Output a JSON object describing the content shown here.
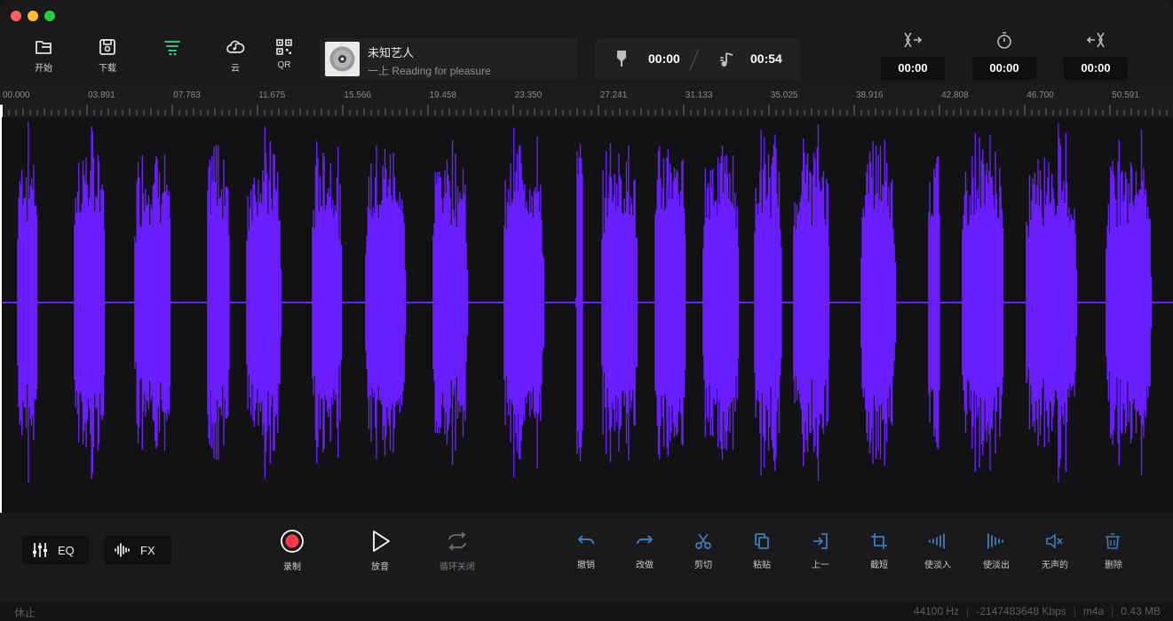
{
  "window": {
    "controls": [
      "close",
      "minimize",
      "zoom"
    ]
  },
  "toolbar": {
    "items": [
      {
        "label": "开始",
        "icon": "folder-open-icon",
        "active": false
      },
      {
        "label": "下载",
        "icon": "save-icon",
        "active": false
      },
      {
        "label": "",
        "icon": "filter-list-icon",
        "active": true
      },
      {
        "label": "云",
        "icon": "cloud-music-icon",
        "active": false
      },
      {
        "label": "QR",
        "icon": "qr-code-icon",
        "active": false
      }
    ]
  },
  "track": {
    "artist": "未知艺人",
    "title": "一上 Reading for pleasure",
    "art_icon": "disc-icon"
  },
  "time": {
    "current": "00:00",
    "total": "00:54"
  },
  "edit_times": {
    "trim_start": "00:00",
    "timer": "00:00",
    "trim_end": "00:00"
  },
  "ruler": {
    "labels": [
      "00.000",
      "03.891",
      "07.783",
      "11.675",
      "15.566",
      "19.458",
      "23.350",
      "27.241",
      "31.133",
      "35.025",
      "38.916",
      "42.808",
      "46.700",
      "50.591"
    ]
  },
  "waveform": {
    "color": "#6a1fff",
    "background": "#121214"
  },
  "bottom": {
    "eq_label": "EQ",
    "fx_label": "FX",
    "record_label": "录制",
    "play_label": "放音",
    "loop_label": "循环关闭",
    "edit": [
      {
        "label": "撤销",
        "icon": "undo-icon"
      },
      {
        "label": "改做",
        "icon": "redo-icon"
      },
      {
        "label": "剪切",
        "icon": "scissors-icon"
      },
      {
        "label": "粘贴",
        "icon": "paste-icon"
      },
      {
        "label": "上一",
        "icon": "insert-icon"
      },
      {
        "label": "截短",
        "icon": "crop-icon"
      },
      {
        "label": "使淡入",
        "icon": "fade-in-icon"
      },
      {
        "label": "使淡出",
        "icon": "fade-out-icon"
      },
      {
        "label": "无声的",
        "icon": "mute-icon"
      },
      {
        "label": "删除",
        "icon": "delete-icon"
      }
    ]
  },
  "status": {
    "state": "休止",
    "sample_rate": "44100 Hz",
    "bitrate": "-2147483648 Kbps",
    "format": "m4a",
    "size": "0.43 MB"
  },
  "colors": {
    "accent": "#3ddc84",
    "record": "#ff3b4a",
    "wave": "#6a1fff"
  }
}
